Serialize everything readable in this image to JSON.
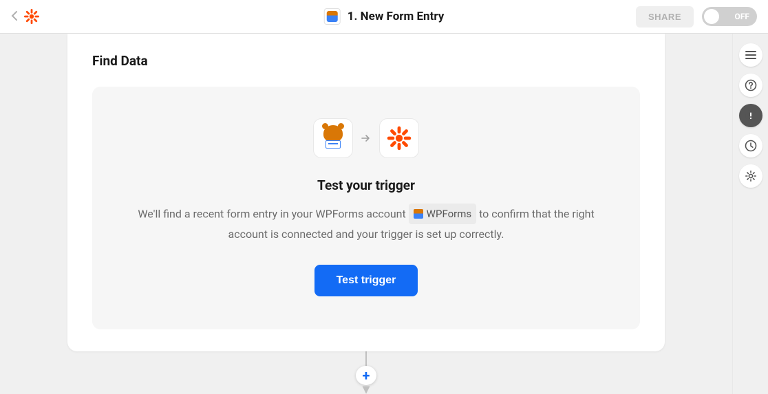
{
  "header": {
    "step_title": "1. New Form Entry",
    "share_label": "SHARE",
    "toggle_label": "OFF"
  },
  "editor": {
    "section_heading": "Find Data",
    "panel_title": "Test your trigger",
    "desc_part1": "We'll find a recent form entry in your WPForms account ",
    "account_chip": "WPForms",
    "desc_part2": " to confirm that the right account is connected and your trigger is set up correctly.",
    "primary_button": "Test trigger"
  },
  "rail": {
    "outline": "outline",
    "help": "help",
    "status": "status",
    "history": "history",
    "settings": "settings"
  },
  "colors": {
    "primary": "#136bf5",
    "accent": "#ff4a00"
  }
}
